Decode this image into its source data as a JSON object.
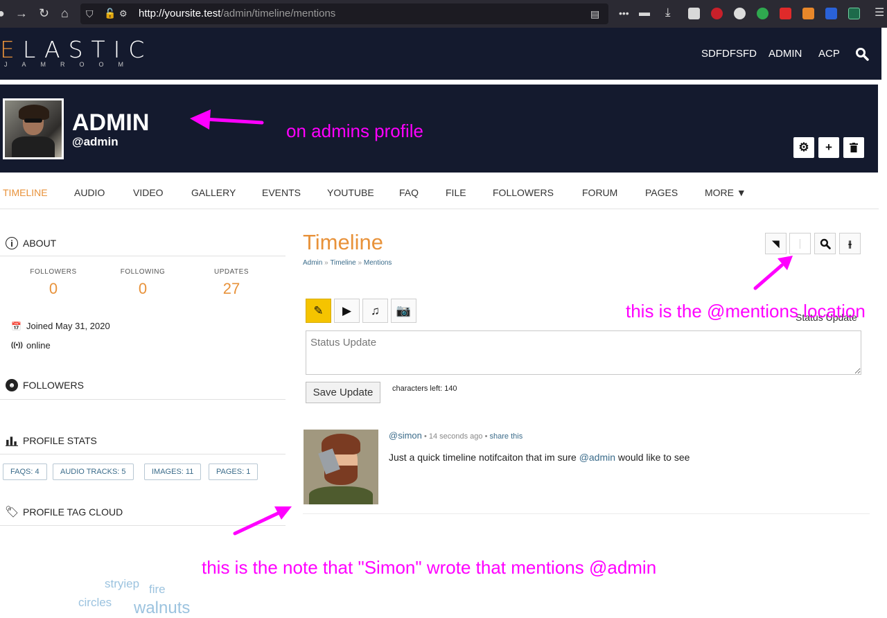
{
  "browser": {
    "url_host": "http://yoursite.test",
    "url_path": "/admin/timeline/mentions",
    "icons": [
      "back-icon",
      "forward-icon",
      "reload-icon",
      "home-icon",
      "shield-icon",
      "reader-icon",
      "menu-dots-icon",
      "download-icon",
      "hamburger-icon"
    ]
  },
  "site": {
    "logo_main": "LASTIC",
    "logo_letter": "E",
    "logo_sub": "JAMROOM",
    "nav": [
      "SDFDFSFD",
      "ADMIN",
      "ACP"
    ],
    "accent_color": "#e8923a",
    "header_bg": "#141a2e"
  },
  "profile": {
    "name": "ADMIN",
    "handle": "@admin"
  },
  "tabs": [
    "TIMELINE",
    "AUDIO",
    "VIDEO",
    "GALLERY",
    "EVENTS",
    "YOUTUBE",
    "FAQ",
    "FILE",
    "FOLLOWERS",
    "FORUM",
    "PAGES",
    "MORE ▼"
  ],
  "sidebar": {
    "about": "ABOUT",
    "stats": [
      {
        "label": "FOLLOWERS",
        "value": "0"
      },
      {
        "label": "FOLLOWING",
        "value": "0"
      },
      {
        "label": "UPDATES",
        "value": "27"
      }
    ],
    "joined": "Joined May 31, 2020",
    "status": "online",
    "followers": "FOLLOWERS",
    "profile_stats": "PROFILE STATS",
    "pills": [
      "FAQS: 4",
      "AUDIO TRACKS: 5",
      "IMAGES: 11",
      "PAGES: 1"
    ],
    "tag_cloud": "PROFILE TAG CLOUD",
    "tags": [
      "stryiep",
      "fire",
      "circles",
      "walnuts"
    ]
  },
  "main": {
    "title": "Timeline",
    "breadcrumb": [
      "Admin",
      "Timeline",
      "Mentions"
    ],
    "status_label": "Status Update",
    "status_placeholder": "Status Update",
    "save_label": "Save Update",
    "chars_left": "characters left: 140"
  },
  "entry": {
    "author": "@simon",
    "time": "14 seconds ago",
    "share": "share this",
    "text_before": "Just a quick timeline notifcaiton that im sure ",
    "mention": "@admin",
    "text_after": " would like to see"
  },
  "annotations": {
    "profile": "on admins profile",
    "mentions": "this is the @mentions location",
    "note": "this is the note that \"Simon\" wrote that mentions @admin",
    "color": "#ff00ff"
  }
}
